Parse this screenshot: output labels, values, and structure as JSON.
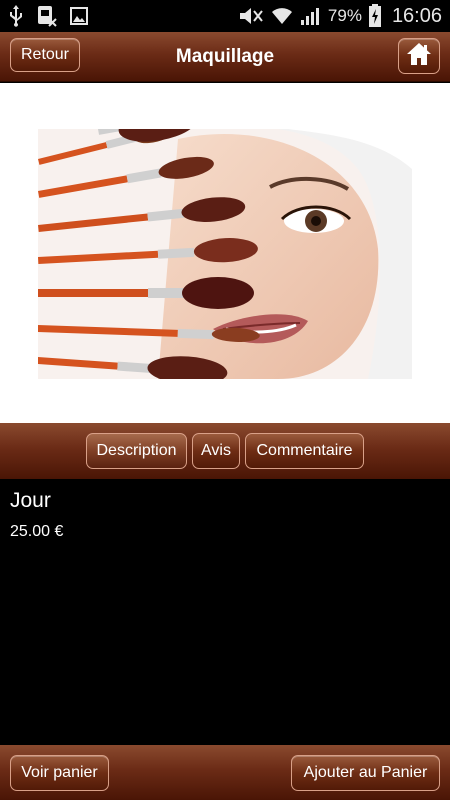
{
  "status_bar": {
    "battery_percent": "79%",
    "time": "16:06",
    "icons": [
      "usb-icon",
      "sim-card-icon",
      "image-icon",
      "mute-icon",
      "wifi-icon",
      "signal-icon",
      "battery-charging-icon"
    ]
  },
  "header": {
    "back_label": "Retour",
    "title": "Maquillage",
    "home_icon": "home-icon"
  },
  "image": {
    "alt": "makeup-brushes-face-photo"
  },
  "tabs": [
    {
      "label": "Description",
      "active": true
    },
    {
      "label": "Avis",
      "active": false
    },
    {
      "label": "Commentaire",
      "active": false
    }
  ],
  "product": {
    "name": "Jour",
    "price": "25.00 €"
  },
  "footer": {
    "cart_label": "Voir panier",
    "add_label": "Ajouter au Panier"
  },
  "colors": {
    "brown_dark": "#4a1505",
    "brown_mid": "#6b2b16",
    "brown_light": "#8a4a2f",
    "button_border": "#d9a088"
  }
}
